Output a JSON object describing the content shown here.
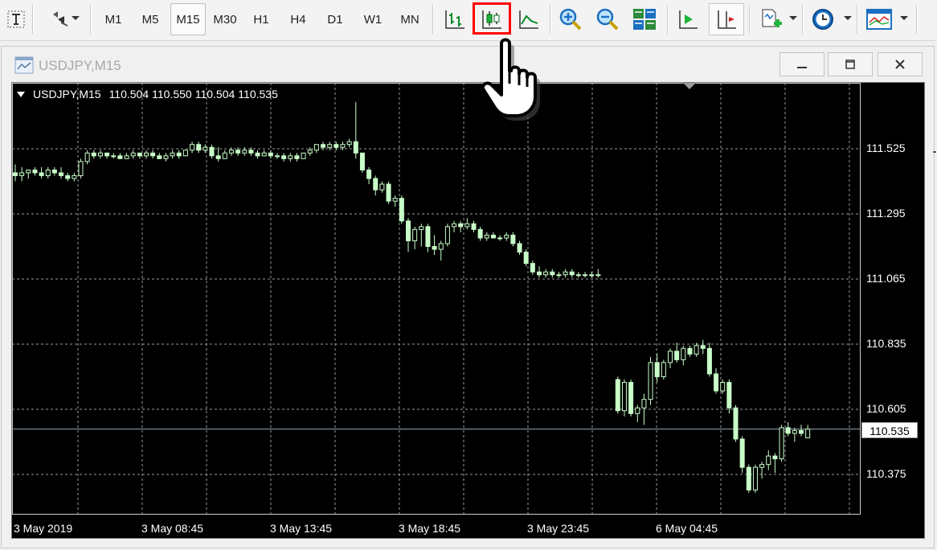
{
  "toolbar": {
    "timeframes": [
      "M1",
      "M5",
      "M15",
      "M30",
      "H1",
      "H4",
      "D1",
      "W1",
      "MN"
    ],
    "active_timeframe": "M15",
    "icons": [
      "text-tool-icon",
      "objects-dropdown-icon",
      "bar-chart-icon",
      "candlestick-chart-icon",
      "line-chart-icon",
      "zoom-in-icon",
      "zoom-out-icon",
      "tile-windows-icon",
      "autoscroll-icon",
      "chart-shift-icon",
      "indicators-icon",
      "periods-icon",
      "templates-icon"
    ],
    "highlighted_button": "candlestick-chart-icon"
  },
  "window": {
    "title": "USDJPY,M15"
  },
  "chart": {
    "header": {
      "symbol": "USDJPY,M15",
      "open": "110.504",
      "high": "110.550",
      "low": "110.504",
      "close": "110.535"
    },
    "price_labels": [
      "111.525",
      "111.295",
      "111.065",
      "110.835",
      "110.605",
      "110.375"
    ],
    "current_price": "110.535",
    "time_labels": [
      "3 May 2019",
      "3 May 08:45",
      "3 May 13:45",
      "3 May 18:45",
      "3 May 23:45",
      "6 May 04:45"
    ],
    "colors": {
      "background": "#000000",
      "candle": "#c8ffc8",
      "grid": "#9a9a9a",
      "text": "#ffffff"
    }
  },
  "chart_data": {
    "type": "candlestick",
    "title": "USDJPY,M15",
    "ylim": [
      110.28,
      111.78
    ],
    "y_ticks": [
      111.525,
      111.295,
      111.065,
      110.835,
      110.605,
      110.375
    ],
    "x_ticks": [
      "3 May 2019",
      "3 May 08:45",
      "3 May 13:45",
      "3 May 18:45",
      "3 May 23:45",
      "6 May 04:45"
    ],
    "current_price": 110.535,
    "candles_ohlc": [
      [
        111.44,
        111.47,
        111.41,
        111.43
      ],
      [
        111.43,
        111.46,
        111.41,
        111.44
      ],
      [
        111.44,
        111.45,
        111.42,
        111.45
      ],
      [
        111.45,
        111.46,
        111.43,
        111.44
      ],
      [
        111.44,
        111.46,
        111.42,
        111.43
      ],
      [
        111.43,
        111.46,
        111.42,
        111.45
      ],
      [
        111.45,
        111.46,
        111.43,
        111.44
      ],
      [
        111.44,
        111.46,
        111.42,
        111.43
      ],
      [
        111.43,
        111.44,
        111.41,
        111.42
      ],
      [
        111.42,
        111.44,
        111.41,
        111.43
      ],
      [
        111.43,
        111.49,
        111.42,
        111.48
      ],
      [
        111.48,
        111.52,
        111.47,
        111.51
      ],
      [
        111.51,
        111.52,
        111.49,
        111.5
      ],
      [
        111.5,
        111.52,
        111.49,
        111.51
      ],
      [
        111.51,
        111.51,
        111.49,
        111.5
      ],
      [
        111.5,
        111.51,
        111.49,
        111.5
      ],
      [
        111.5,
        111.51,
        111.49,
        111.49
      ],
      [
        111.49,
        111.51,
        111.49,
        111.5
      ],
      [
        111.5,
        111.52,
        111.49,
        111.51
      ],
      [
        111.51,
        111.51,
        111.49,
        111.5
      ],
      [
        111.5,
        111.52,
        111.49,
        111.51
      ],
      [
        111.51,
        111.52,
        111.49,
        111.5
      ],
      [
        111.5,
        111.51,
        111.49,
        111.49
      ],
      [
        111.49,
        111.51,
        111.48,
        111.5
      ],
      [
        111.5,
        111.52,
        111.49,
        111.51
      ],
      [
        111.51,
        111.52,
        111.49,
        111.5
      ],
      [
        111.5,
        111.52,
        111.5,
        111.52
      ],
      [
        111.52,
        111.55,
        111.51,
        111.54
      ],
      [
        111.54,
        111.55,
        111.51,
        111.52
      ],
      [
        111.52,
        111.54,
        111.51,
        111.53
      ],
      [
        111.53,
        111.54,
        111.49,
        111.5
      ],
      [
        111.5,
        111.53,
        111.48,
        111.49
      ],
      [
        111.49,
        111.52,
        111.49,
        111.51
      ],
      [
        111.51,
        111.53,
        111.5,
        111.52
      ],
      [
        111.52,
        111.53,
        111.5,
        111.51
      ],
      [
        111.51,
        111.53,
        111.5,
        111.52
      ],
      [
        111.52,
        111.53,
        111.5,
        111.51
      ],
      [
        111.51,
        111.52,
        111.49,
        111.5
      ],
      [
        111.5,
        111.52,
        111.5,
        111.51
      ],
      [
        111.51,
        111.52,
        111.49,
        111.5
      ],
      [
        111.5,
        111.51,
        111.49,
        111.5
      ],
      [
        111.5,
        111.51,
        111.48,
        111.49
      ],
      [
        111.49,
        111.51,
        111.48,
        111.5
      ],
      [
        111.5,
        111.51,
        111.48,
        111.49
      ],
      [
        111.49,
        111.51,
        111.49,
        111.51
      ],
      [
        111.51,
        111.53,
        111.5,
        111.52
      ],
      [
        111.52,
        111.54,
        111.51,
        111.54
      ],
      [
        111.54,
        111.55,
        111.52,
        111.53
      ],
      [
        111.53,
        111.55,
        111.52,
        111.54
      ],
      [
        111.54,
        111.55,
        111.52,
        111.53
      ],
      [
        111.53,
        111.55,
        111.52,
        111.54
      ],
      [
        111.54,
        111.56,
        111.53,
        111.55
      ],
      [
        111.55,
        111.69,
        111.49,
        111.51
      ],
      [
        111.51,
        111.51,
        111.44,
        111.45
      ],
      [
        111.45,
        111.46,
        111.4,
        111.42
      ],
      [
        111.42,
        111.43,
        111.36,
        111.38
      ],
      [
        111.38,
        111.41,
        111.37,
        111.4
      ],
      [
        111.4,
        111.41,
        111.33,
        111.34
      ],
      [
        111.34,
        111.36,
        111.32,
        111.35
      ],
      [
        111.35,
        111.36,
        111.26,
        111.27
      ],
      [
        111.27,
        111.28,
        111.16,
        111.2
      ],
      [
        111.2,
        111.25,
        111.17,
        111.24
      ],
      [
        111.24,
        111.26,
        111.18,
        111.25
      ],
      [
        111.25,
        111.26,
        111.16,
        111.18
      ],
      [
        111.18,
        111.22,
        111.15,
        111.17
      ],
      [
        111.17,
        111.2,
        111.13,
        111.19
      ],
      [
        111.19,
        111.26,
        111.18,
        111.25
      ],
      [
        111.25,
        111.27,
        111.23,
        111.26
      ],
      [
        111.26,
        111.27,
        111.23,
        111.25
      ],
      [
        111.25,
        111.28,
        111.24,
        111.26
      ],
      [
        111.26,
        111.27,
        111.23,
        111.24
      ],
      [
        111.24,
        111.25,
        111.2,
        111.21
      ],
      [
        111.21,
        111.23,
        111.2,
        111.22
      ],
      [
        111.22,
        111.23,
        111.21,
        111.21
      ],
      [
        111.21,
        111.22,
        111.2,
        111.21
      ],
      [
        111.21,
        111.23,
        111.2,
        111.22
      ],
      [
        111.22,
        111.23,
        111.18,
        111.19
      ],
      [
        111.19,
        111.2,
        111.15,
        111.16
      ],
      [
        111.16,
        111.17,
        111.11,
        111.12
      ],
      [
        111.12,
        111.13,
        111.08,
        111.09
      ],
      [
        111.09,
        111.11,
        111.07,
        111.08
      ],
      [
        111.08,
        111.1,
        111.07,
        111.09
      ],
      [
        111.09,
        111.1,
        111.07,
        111.08
      ],
      [
        111.08,
        111.09,
        111.07,
        111.08
      ],
      [
        111.08,
        111.1,
        111.07,
        111.09
      ],
      [
        111.09,
        111.1,
        111.07,
        111.08
      ],
      [
        111.08,
        111.09,
        111.07,
        111.08
      ],
      [
        111.08,
        111.09,
        111.07,
        111.08
      ],
      [
        111.08,
        111.09,
        111.07,
        111.08
      ],
      [
        111.08,
        111.1,
        111.07,
        111.08
      ],
      [
        110.71,
        110.72,
        110.59,
        110.6
      ],
      [
        110.6,
        110.71,
        110.58,
        110.7
      ],
      [
        110.7,
        110.71,
        110.58,
        110.59
      ],
      [
        110.59,
        110.62,
        110.56,
        110.61
      ],
      [
        110.61,
        110.66,
        110.55,
        110.64
      ],
      [
        110.64,
        110.79,
        110.62,
        110.77
      ],
      [
        110.77,
        110.8,
        110.7,
        110.72
      ],
      [
        110.72,
        110.78,
        110.71,
        110.77
      ],
      [
        110.77,
        110.82,
        110.75,
        110.81
      ],
      [
        110.81,
        110.84,
        110.77,
        110.78
      ],
      [
        110.78,
        110.83,
        110.76,
        110.82
      ],
      [
        110.82,
        110.83,
        110.79,
        110.8
      ],
      [
        110.8,
        110.84,
        110.79,
        110.83
      ],
      [
        110.83,
        110.85,
        110.8,
        110.82
      ],
      [
        110.82,
        110.84,
        110.72,
        110.73
      ],
      [
        110.73,
        110.75,
        110.66,
        110.67
      ],
      [
        110.67,
        110.71,
        110.66,
        110.7
      ],
      [
        110.7,
        110.71,
        110.59,
        110.61
      ],
      [
        110.61,
        110.62,
        110.49,
        110.5
      ],
      [
        110.5,
        110.51,
        110.38,
        110.4
      ],
      [
        110.4,
        110.41,
        110.31,
        110.32
      ],
      [
        110.32,
        110.41,
        110.31,
        110.4
      ],
      [
        110.4,
        110.42,
        110.36,
        110.41
      ],
      [
        110.41,
        110.46,
        110.39,
        110.44
      ],
      [
        110.44,
        110.45,
        110.38,
        110.43
      ],
      [
        110.43,
        110.55,
        110.42,
        110.54
      ],
      [
        110.54,
        110.56,
        110.51,
        110.52
      ],
      [
        110.52,
        110.54,
        110.49,
        110.53
      ],
      [
        110.53,
        110.55,
        110.51,
        110.52
      ],
      [
        110.504,
        110.55,
        110.504,
        110.535
      ]
    ]
  }
}
